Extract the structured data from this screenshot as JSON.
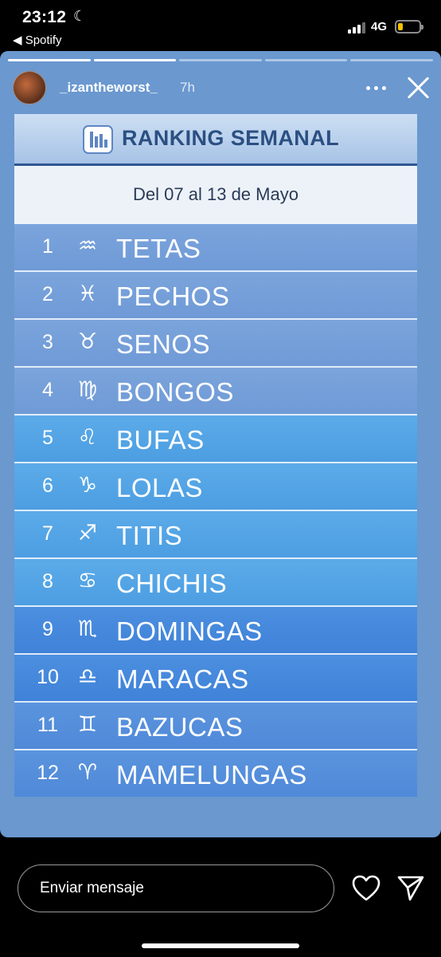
{
  "status_bar": {
    "time": "23:12",
    "moon_glyph": "☾",
    "back_app": "◀ Spotify",
    "network": "4G"
  },
  "story": {
    "username": "_izantheworst_",
    "posted_ago": "7h",
    "progress_segments_total": 5,
    "progress_segments_done": 2
  },
  "ranking": {
    "title": "RANKING SEMANAL",
    "date_range": "Del 07 al 13 de Mayo",
    "items": [
      {
        "rank": "1",
        "sign": "♒",
        "name": "TETAS"
      },
      {
        "rank": "2",
        "sign": "♓",
        "name": "PECHOS"
      },
      {
        "rank": "3",
        "sign": "♉",
        "name": "SENOS"
      },
      {
        "rank": "4",
        "sign": "♍",
        "name": "BONGOS"
      },
      {
        "rank": "5",
        "sign": "♌",
        "name": "BUFAS"
      },
      {
        "rank": "6",
        "sign": "♑",
        "name": "LOLAS"
      },
      {
        "rank": "7",
        "sign": "♐",
        "name": "TITIS"
      },
      {
        "rank": "8",
        "sign": "♋",
        "name": "CHICHIS"
      },
      {
        "rank": "9",
        "sign": "♏",
        "name": "DOMINGAS"
      },
      {
        "rank": "10",
        "sign": "♎",
        "name": "MARACAS"
      },
      {
        "rank": "11",
        "sign": "♊",
        "name": "BAZUCAS"
      },
      {
        "rank": "12",
        "sign": "♈",
        "name": "MAMELUNGAS"
      }
    ]
  },
  "message_bar": {
    "placeholder": "Enviar mensaje"
  },
  "icons": {
    "heart": "heart-icon",
    "send": "send-icon",
    "close": "close-icon",
    "more": "more-icon"
  },
  "colors": {
    "story_background": "#6a98cf",
    "title_color": "#2b4f82",
    "battery_fill": "#f2c200"
  }
}
